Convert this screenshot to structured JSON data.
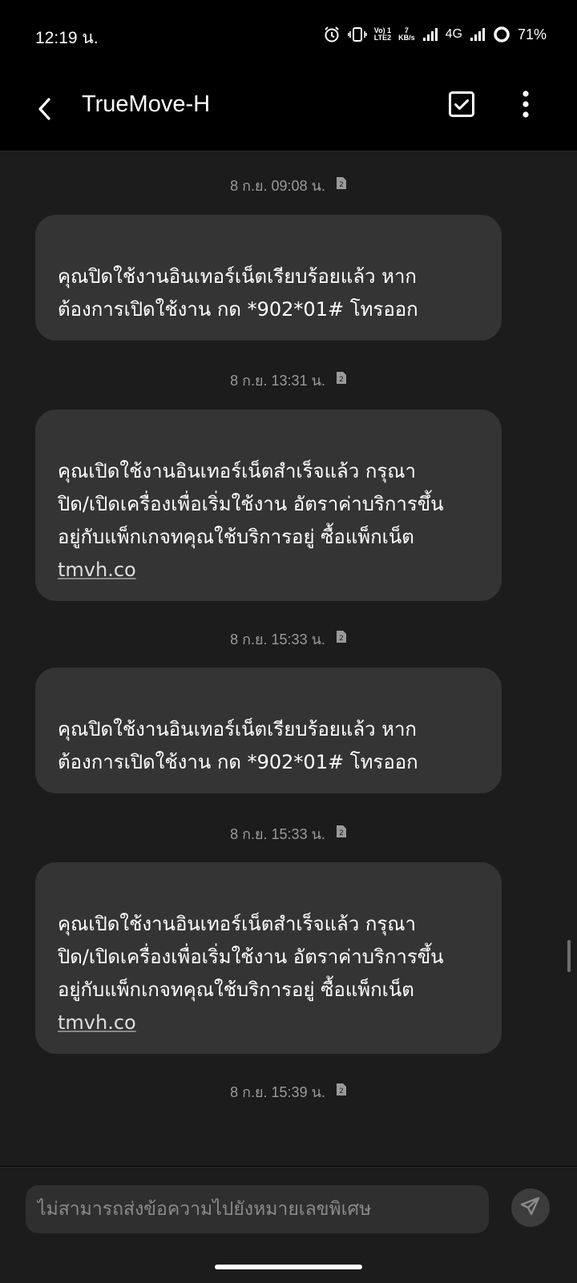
{
  "status_bar": {
    "time": "12:19 น.",
    "network_rate": "7",
    "network_rate_unit": "KB/s",
    "volte_top": "Vo) 1",
    "volte_bottom": "LTE2",
    "network_type": "4G",
    "battery": "71%",
    "icons": [
      "alarm-icon",
      "vibrate-icon",
      "volte-icon",
      "signal-icon",
      "signal-icon",
      "battery-ring-icon"
    ]
  },
  "app_bar": {
    "title": "TrueMove-H",
    "icons": [
      "back-arrow-icon",
      "select-checkbox-icon",
      "more-vert-icon"
    ]
  },
  "messages": [
    {
      "timestamp": "8 ก.ย. 09:08 น.",
      "sim_badge": "2",
      "text": "คุณปิดใช้งานอินเทอร์เน็ตเรียบร้อยแล้ว หาก\nต้องการเปิดใช้งาน กด *902*01# โทรออก",
      "link": ""
    },
    {
      "timestamp": "8 ก.ย. 13:31 น.",
      "sim_badge": "2",
      "text": "คุณเปิดใช้งานอินเทอร์เน็ตสำเร็จแล้ว กรุณา\nปิด/เปิดเครื่องเพื่อเริ่มใช้งาน อัตราค่าบริการขึ้น\nอยู่กับแพ็กเกจทคุณใช้บริการอยู่ ซื้อแพ็กเน็ต\n",
      "link": "tmvh.co"
    },
    {
      "timestamp": "8 ก.ย. 15:33 น.",
      "sim_badge": "2",
      "text": "คุณปิดใช้งานอินเทอร์เน็ตเรียบร้อยแล้ว หาก\nต้องการเปิดใช้งาน กด *902*01# โทรออก",
      "link": ""
    },
    {
      "timestamp": "8 ก.ย. 15:33 น.",
      "sim_badge": "2",
      "text": "คุณเปิดใช้งานอินเทอร์เน็ตสำเร็จแล้ว กรุณา\nปิด/เปิดเครื่องเพื่อเริ่มใช้งาน อัตราค่าบริการขึ้น\nอยู่กับแพ็กเกจทคุณใช้บริการอยู่ ซื้อแพ็กเน็ต\n",
      "link": "tmvh.co"
    }
  ],
  "trailing_timestamp": {
    "timestamp": "8 ก.ย. 15:39 น.",
    "sim_badge": "2"
  },
  "composer": {
    "placeholder": "ไม่สามารถส่งข้อความไปยังหมายเลขพิเศษ",
    "send_icon": "send-icon"
  },
  "colors": {
    "background": "#000000",
    "conversation_background": "#1c1c1c",
    "bubble": "#343434",
    "timestamp_text": "#9a9a9a"
  }
}
